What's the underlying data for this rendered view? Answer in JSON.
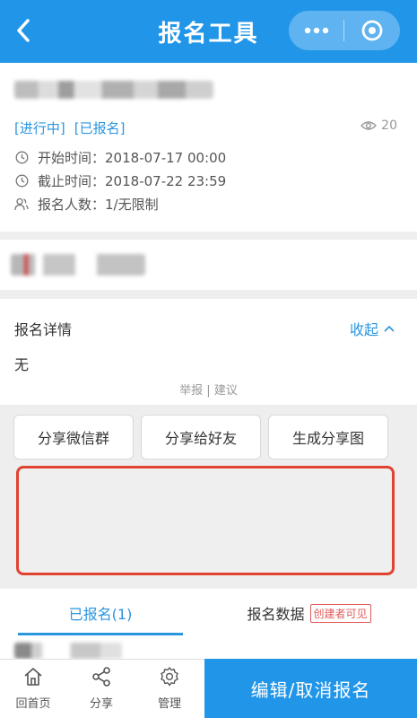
{
  "navbar": {
    "title": "报名工具",
    "bg_color": "#2196e8",
    "back_icon": "chevron-left-icon",
    "more_icon": "more-dots-icon",
    "close_icon": "target-circle-icon"
  },
  "event": {
    "tags": [
      "[进行中]",
      "[已报名]"
    ],
    "views": "20",
    "start": {
      "label": "开始时间：",
      "value": "2018-07-17 00:00"
    },
    "end": {
      "label": "截止时间：",
      "value": "2018-07-22 23:59"
    },
    "participants": {
      "label": "报名人数：",
      "value": "1/无限制"
    }
  },
  "detail": {
    "title": "报名详情",
    "collapse_label": "收起",
    "body": "无",
    "report": "举报",
    "suggest": "建议",
    "separator": " | "
  },
  "share_buttons": [
    "分享微信群",
    "分享给好友",
    "生成分享图"
  ],
  "tabs": {
    "registered": "已报名(1)",
    "data": "报名数据",
    "creator_badge": "创建者可见"
  },
  "toolbar": {
    "home": "回首页",
    "share": "分享",
    "manage": "管理"
  },
  "main_action": "编辑/取消报名",
  "colors": {
    "accent": "#2196e8",
    "link": "#2a96e0",
    "highlight_border": "#e0432f"
  }
}
